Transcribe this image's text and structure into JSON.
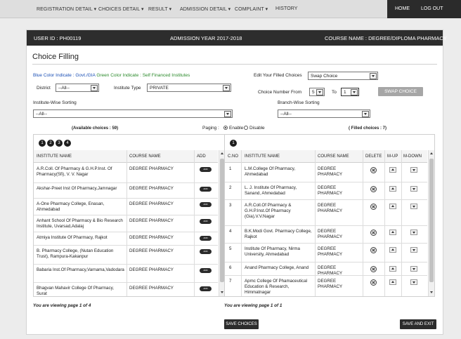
{
  "nav": {
    "items": [
      "REGISTRATION DETAIL ▾",
      "CHOICES DETAIL ▾",
      "RESULT ▾",
      "ADMISSION DETAIL ▾",
      "COMPLAINT ▾",
      "HISTORY"
    ],
    "home": "HOME",
    "logout": "LOG OUT"
  },
  "infobar": {
    "user": "USER ID : PH00119",
    "year": "ADMISSION YEAR  2017-2018",
    "course": "COURSE NAME : DEGREE/DIPLOMA PHARMACY"
  },
  "page_title": "Choice Filling",
  "legend": {
    "blue": "Blue Color Indicate : Govt./GIA",
    "green": "Green Color Indicate : Self Financed Institutes"
  },
  "filters": {
    "district_label": "District",
    "district_value": "--All--",
    "type_label": "Institute Type",
    "type_value": "PRIVATE",
    "edit_label": "Edit Your Filled Choices",
    "edit_value": "Swap Choice",
    "choice_from_label": "Choice Number From",
    "choice_from_value": "5",
    "to_label": "To",
    "to_value": "1",
    "swap_button": "SWAP CHOICE",
    "inst_sort_label": "Institute-Wise Sorting",
    "inst_sort_value": "--All--",
    "branch_sort_label": "Branch-Wise Sorting",
    "branch_sort_value": "--All--"
  },
  "available_label": "(Available choices : 59)",
  "filled_label": "( Filled choices : 7)",
  "paging": {
    "label": "Paging :",
    "enable": "Enable",
    "disable": "Disable"
  },
  "left_table": {
    "pages": [
      "1",
      "2",
      "3",
      "4"
    ],
    "headers": [
      "INSTITUTE NAME",
      "COURSE NAME",
      "ADD"
    ],
    "add_label": "ADD",
    "rows": [
      {
        "inst": "A.R.Coll. Of Pharmacy & G.H.P.Inst. Of Pharmacy(Sfi), V. V. Nagar",
        "course": "DEGREE PHARMACY"
      },
      {
        "inst": "Akshar-Preet Inst Of Pharmacy,Jamnagar",
        "course": "DEGREE PHARMACY"
      },
      {
        "inst": "A-One Pharmacy College, Enasan, Ahmedabad",
        "course": "DEGREE PHARMACY"
      },
      {
        "inst": "Anhant School Of Pharmacy & Bio Research Institute, Uvarsad,Adalaj",
        "course": "DEGREE PHARMACY"
      },
      {
        "inst": "Atmiya Institute Of Pharmacy, Rajkot",
        "course": "DEGREE PHARMACY"
      },
      {
        "inst": "B. Pharmacy College, (Nutan Education Trust), Rampura-Kakanpur",
        "course": "DEGREE PHARMACY"
      },
      {
        "inst": "Babaria Inst.Of Pharmacy,Varnama,Vadodara",
        "course": "DEGREE PHARMACY"
      },
      {
        "inst": "Bhagvan Mahavir College Of Pharmacy, Surat",
        "course": "DEGREE PHARMACY"
      }
    ],
    "viewing": "You are viewing page 1 of 4"
  },
  "right_table": {
    "pages": [
      "1"
    ],
    "headers": [
      "C.NO",
      "INSTITUTE NAME",
      "COURSE NAME",
      "DELETE",
      "M-UP",
      "M-DOWN"
    ],
    "rows": [
      {
        "no": "1",
        "inst": "L.M.College Of Pharmacy, Ahmedabad",
        "course": "DEGREE PHARMACY"
      },
      {
        "no": "2",
        "inst": "L. J. Institute Of Pharmacy, Sanand, Ahmedabad",
        "course": "DEGREE PHARMACY"
      },
      {
        "no": "3",
        "inst": "A.R.Coll.Of Pharmacy & G.H.P.Inst.Of Pharmacy (Gia),V.V.Nagar",
        "course": "DEGREE PHARMACY"
      },
      {
        "no": "4",
        "inst": "B.K.Modi Govt. Pharmacy College, Rajkot",
        "course": "DEGREE PHARMACY"
      },
      {
        "no": "5",
        "inst": "Institute Of Pharmacy, Nirma University, Ahmedabad",
        "course": "DEGREE PHARMACY"
      },
      {
        "no": "6",
        "inst": "Anand Pharmacy College, Anand",
        "course": "DEGREE PHARMACY"
      },
      {
        "no": "7",
        "inst": "Apmc College Of Phamaceutical Education & Research, Himmatnagar",
        "course": "DEGREE PHARMACY"
      }
    ],
    "viewing": "You are viewing page 1 of 1"
  },
  "buttons": {
    "save": "SAVE CHOICES",
    "save_exit": "SAVE AND EXIT"
  }
}
